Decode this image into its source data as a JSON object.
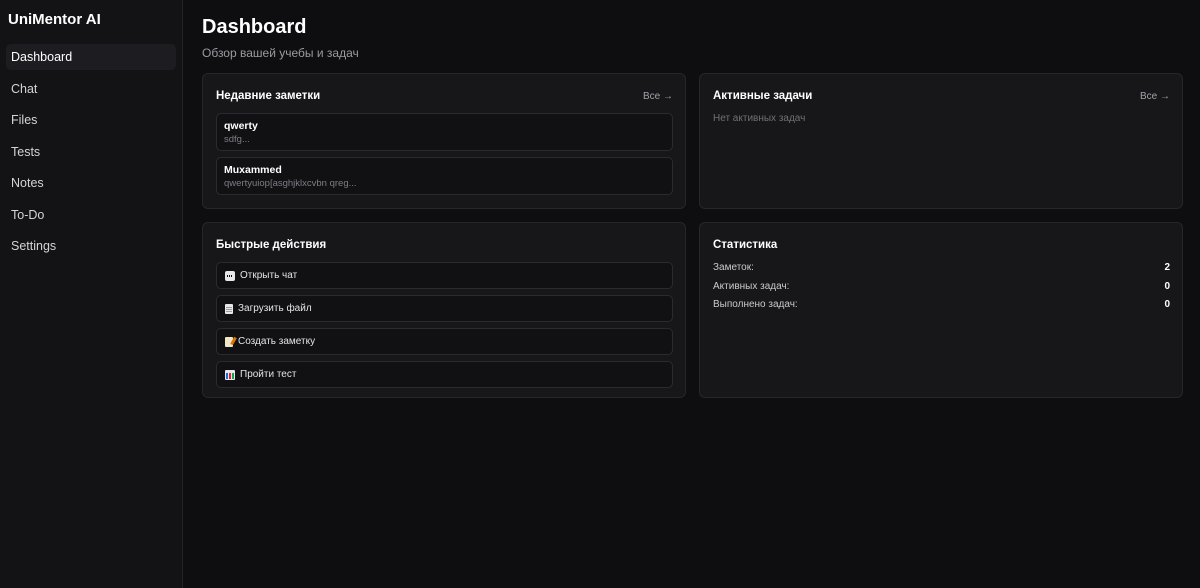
{
  "app": {
    "brand": "UniMentor AI"
  },
  "sidebar": {
    "items": [
      {
        "label": "Dashboard"
      },
      {
        "label": "Chat"
      },
      {
        "label": "Files"
      },
      {
        "label": "Tests"
      },
      {
        "label": "Notes"
      },
      {
        "label": "To-Do"
      },
      {
        "label": "Settings"
      }
    ],
    "active": "Dashboard"
  },
  "header": {
    "title": "Dashboard",
    "subtitle": "Обзор вашей учебы и задач"
  },
  "recent_notes": {
    "title": "Недавние заметки",
    "see_all": "Все →",
    "items": [
      {
        "title": "qwerty",
        "preview": "sdfg..."
      },
      {
        "title": "Muxammed",
        "preview": "qwertyuiop[asghjklxcvbn qreg..."
      }
    ]
  },
  "active_tasks": {
    "title": "Активные задачи",
    "see_all": "Все →",
    "empty": "Нет активных задач"
  },
  "quick_actions": {
    "title": "Быстрые действия",
    "items": [
      {
        "label": "Открыть чат",
        "icon": "speech-balloon-icon"
      },
      {
        "label": "Загрузить файл",
        "icon": "page-icon"
      },
      {
        "label": "Создать заметку",
        "icon": "memo-icon"
      },
      {
        "label": "Пройти тест",
        "icon": "bar-chart-icon"
      }
    ]
  },
  "stats": {
    "title": "Статистика",
    "rows": [
      {
        "label": "Заметок:",
        "value": "2"
      },
      {
        "label": "Активных задач:",
        "value": "0"
      },
      {
        "label": "Выполнено задач:",
        "value": "0"
      }
    ]
  },
  "colors": {
    "background": "#0e0e10",
    "sidebar": "#131316",
    "card": "#17171a",
    "border": "#26262b",
    "text": "#ffffff",
    "muted": "#9a9aa2"
  }
}
